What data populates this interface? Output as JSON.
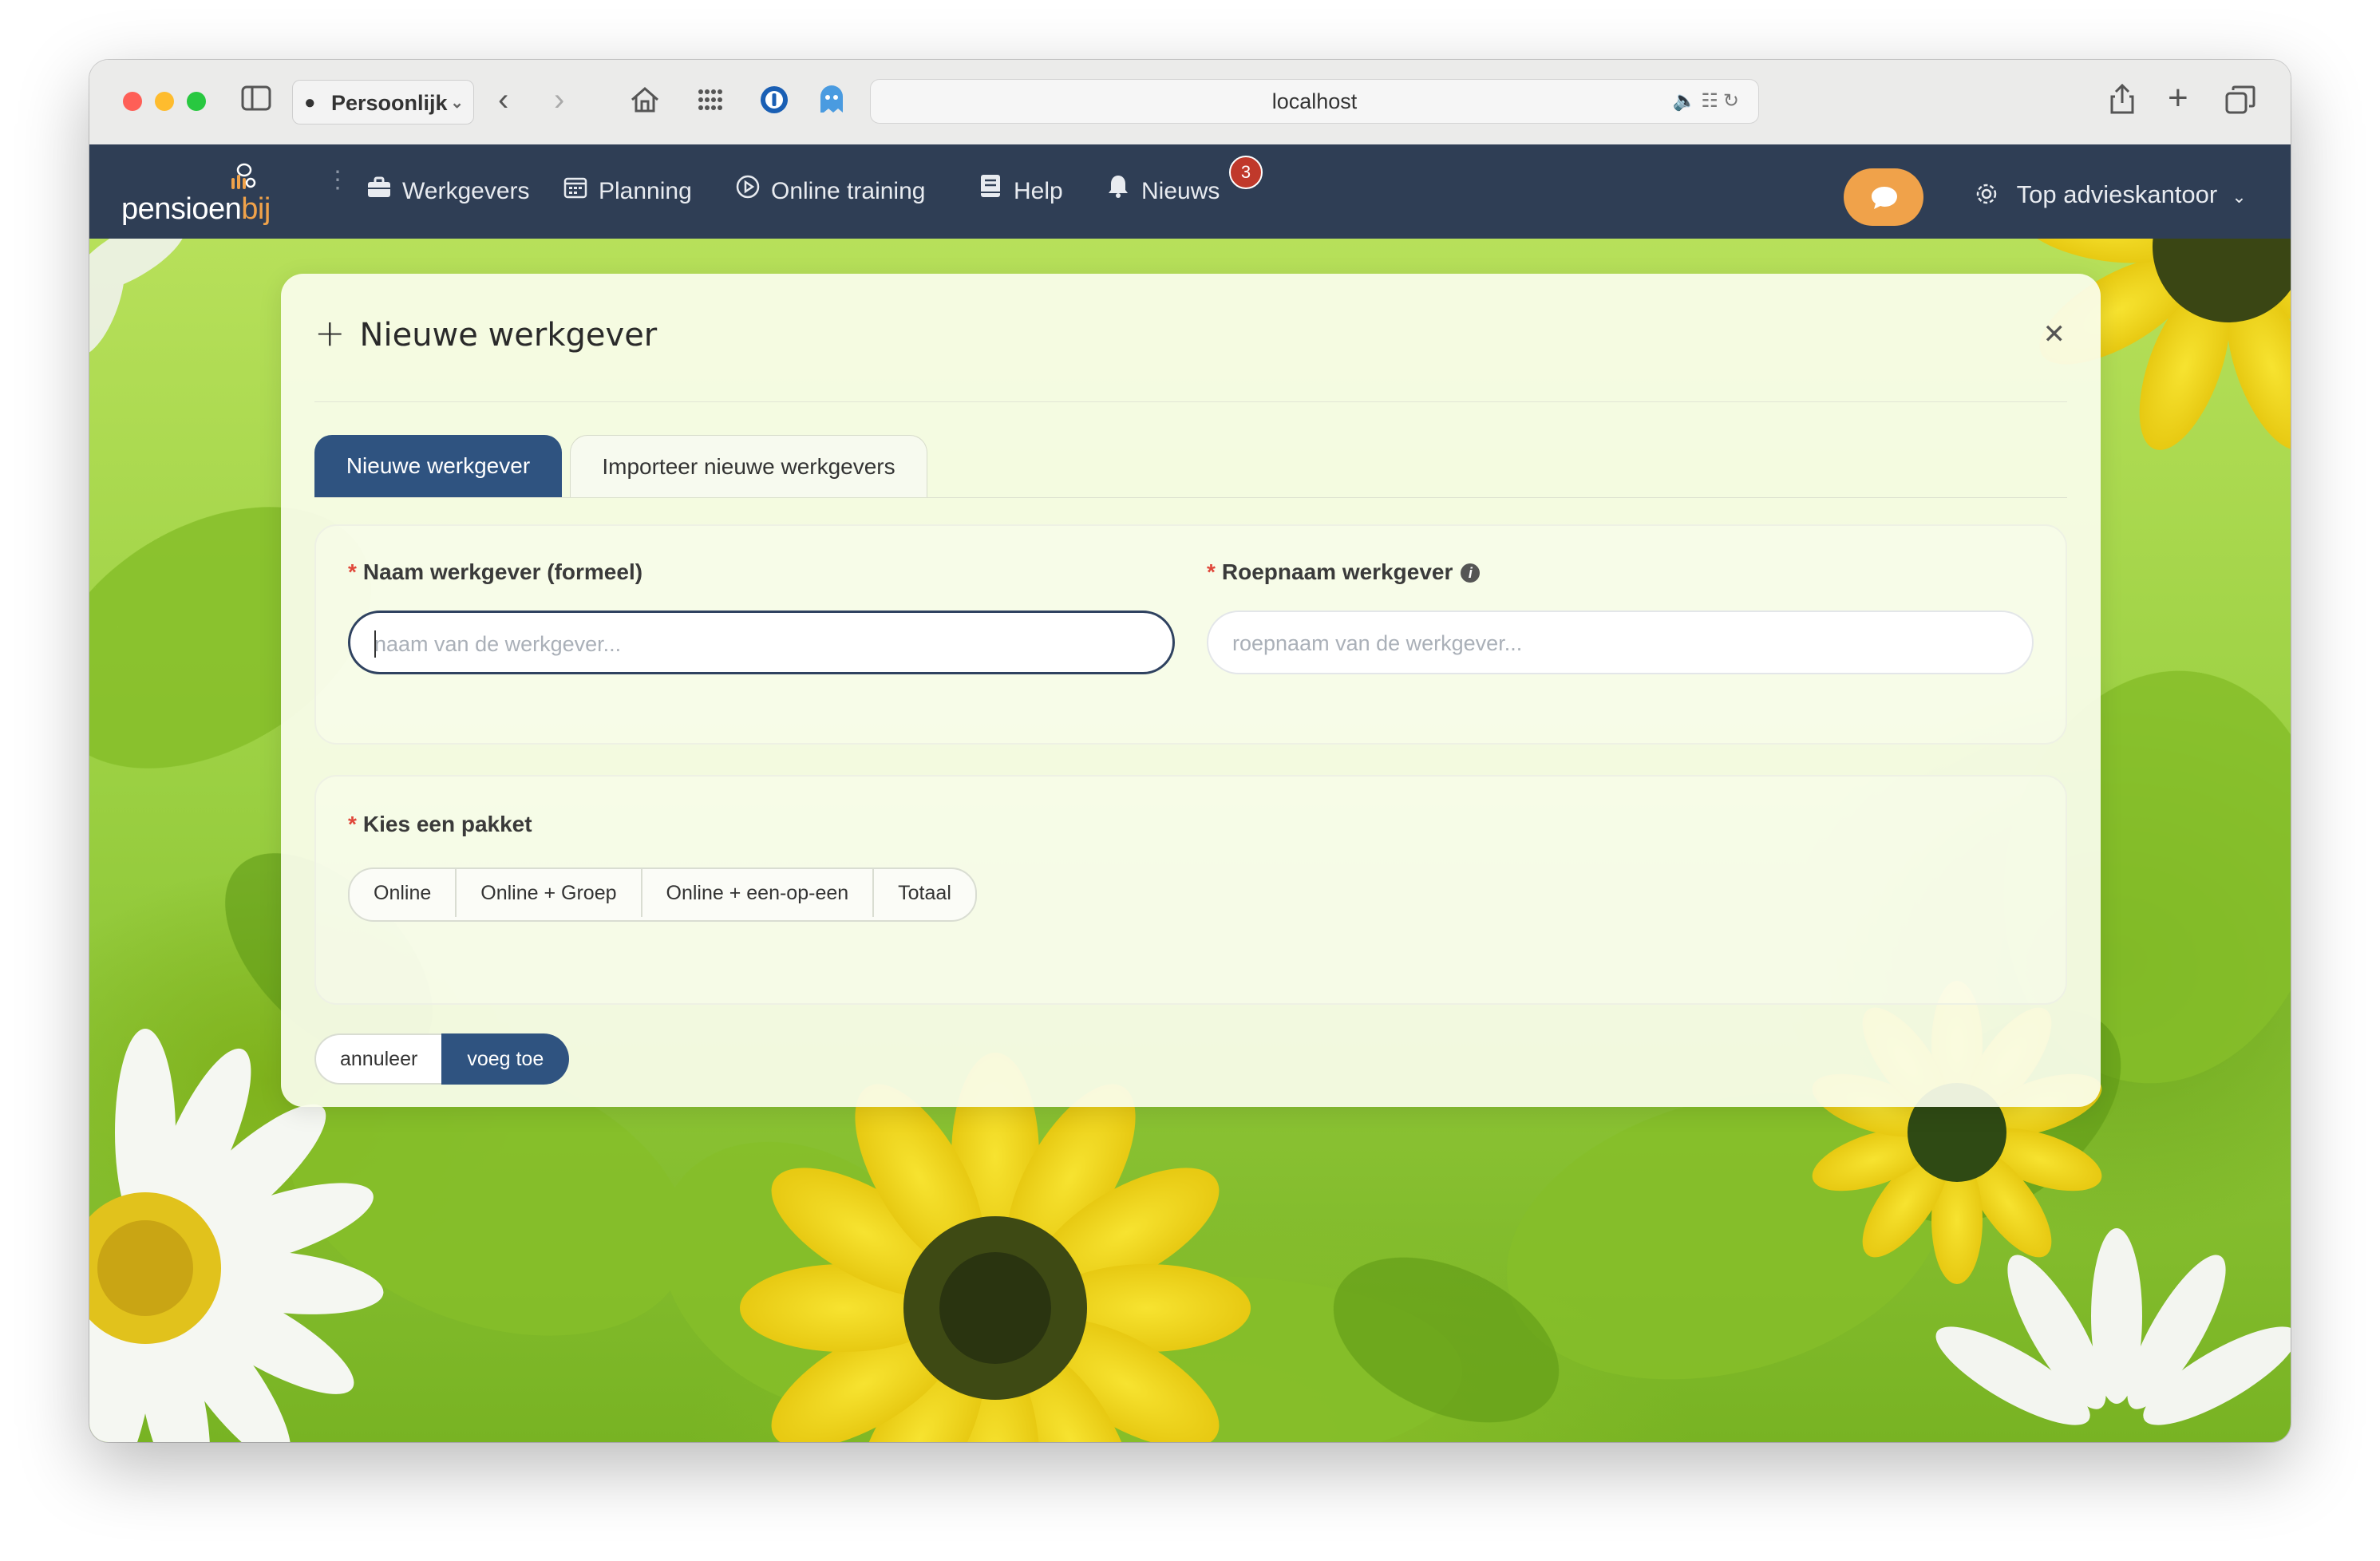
{
  "browser": {
    "profile_label": "Persoonlijk",
    "url": "localhost"
  },
  "nav": {
    "logo_text_main": "pensioen",
    "logo_text_accent": "bij",
    "items": [
      {
        "label": "Werkgevers",
        "icon": "briefcase-icon"
      },
      {
        "label": "Planning",
        "icon": "calendar-icon"
      },
      {
        "label": "Online training",
        "icon": "play-circle-icon"
      },
      {
        "label": "Help",
        "icon": "book-icon"
      },
      {
        "label": "Nieuws",
        "icon": "bell-icon"
      }
    ],
    "news_badge": "3",
    "account_label": "Top advieskantoor",
    "accent_color": "#f0a24a",
    "nav_bg": "#2f3e55"
  },
  "modal": {
    "title": "Nieuwe werkgever",
    "tabs": [
      {
        "label": "Nieuwe werkgever",
        "active": true
      },
      {
        "label": "Importeer nieuwe werkgevers",
        "active": false
      }
    ],
    "fields": {
      "formal_name": {
        "label": "Naam werkgever (formeel)",
        "placeholder": "naam van de werkgever...",
        "required": "*"
      },
      "nickname": {
        "label": "Roepnaam werkgever",
        "placeholder": "roepnaam van de werkgever...",
        "required": "*",
        "info": "i"
      },
      "package": {
        "label": "Kies een pakket",
        "required": "*",
        "options": [
          "Online",
          "Online + Groep",
          "Online + een-op-een",
          "Totaal"
        ]
      }
    },
    "buttons": {
      "cancel": "annuleer",
      "submit": "voeg toe"
    },
    "primary_color": "#2f5380"
  }
}
